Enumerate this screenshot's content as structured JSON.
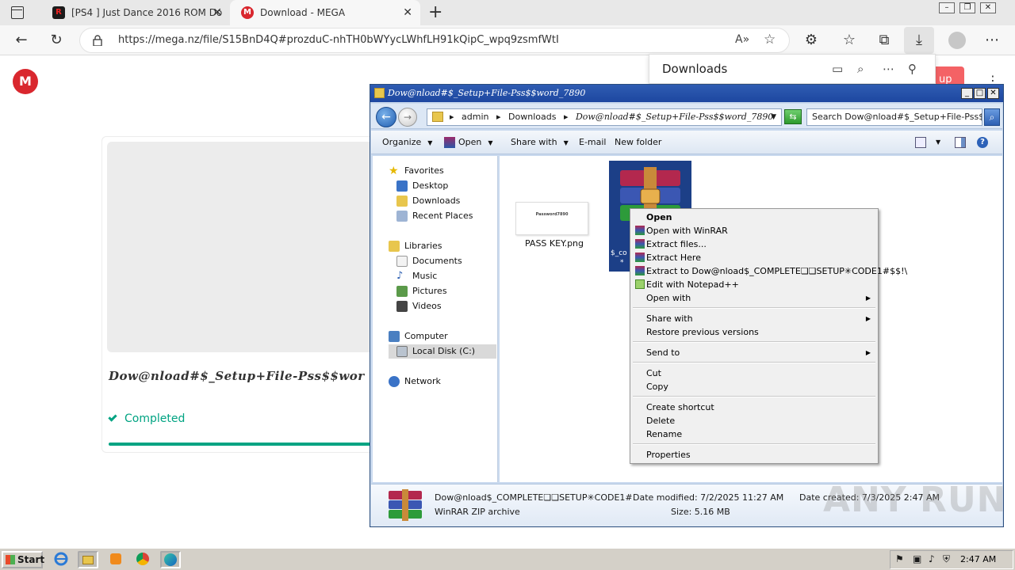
{
  "browser": {
    "tabs": [
      {
        "title": "[PS4 ] Just Dance 2016 ROM Do",
        "favicon": "R"
      },
      {
        "title": "Download - MEGA",
        "favicon": "M"
      }
    ],
    "url": "https://mega.nz/file/S15BnD4Q#prozduC-nhTH0bWYycLWhfLH91kQipC_wpq9zsmfWtI"
  },
  "mega": {
    "file_name": "Dow@nload#$_Setup+File-Pss$$wor",
    "status": "Completed",
    "progress": 1.0,
    "signup_label": "up",
    "logo": "M"
  },
  "downloads_panel": {
    "title": "Downloads"
  },
  "explorer": {
    "title": "Dow@nload#$_Setup+File-Pss$$word_7890",
    "breadcrumbs": [
      "admin",
      "Downloads",
      "Dow@nload#$_Setup+File-Pss$$word_7890"
    ],
    "search_placeholder": "Search Dow@nload#$_Setup+File-Pss$...",
    "commands": {
      "organize": "Organize",
      "open": "Open",
      "share": "Share with",
      "email": "E-mail",
      "new_folder": "New folder"
    },
    "nav": {
      "favorites": "Favorites",
      "desktop": "Desktop",
      "downloads": "Downloads",
      "recent": "Recent Places",
      "libraries": "Libraries",
      "documents": "Documents",
      "music": "Music",
      "pictures": "Pictures",
      "videos": "Videos",
      "computer": "Computer",
      "local_disk": "Local Disk (C:)",
      "network": "Network"
    },
    "files": {
      "png_name": "PASS KEY.png",
      "png_thumb_text": "Password7890",
      "rar_caption": "$_co",
      "rar_caption2": "*"
    },
    "details": {
      "name": "Dow@nload$_COMPLETE❏❏SETUP✳CODE1#$$!...",
      "type": "WinRAR ZIP archive",
      "modified": "Date modified: 7/2/2025 11:27 AM",
      "created": "Date created: 7/3/2025 2:47 AM",
      "size": "Size: 5.16 MB"
    }
  },
  "context_menu": {
    "open": "Open",
    "open_winrar": "Open with WinRAR",
    "extract_files": "Extract files...",
    "extract_here": "Extract Here",
    "extract_to": "Extract to Dow@nload$_COMPLETE❏❏SETUP✳CODE1#$$!\\",
    "edit_notepad": "Edit with Notepad++",
    "open_with": "Open with",
    "share_with": "Share with",
    "restore": "Restore previous versions",
    "send_to": "Send to",
    "cut": "Cut",
    "copy": "Copy",
    "create_shortcut": "Create shortcut",
    "delete": "Delete",
    "rename": "Rename",
    "properties": "Properties"
  },
  "taskbar": {
    "start": "Start",
    "clock": "2:47 AM"
  },
  "watermark": "ANY RUN",
  "colors": {
    "mega_red": "#d9272e",
    "mega_green": "#00a382",
    "explorer_title": "#2f5cb2"
  }
}
